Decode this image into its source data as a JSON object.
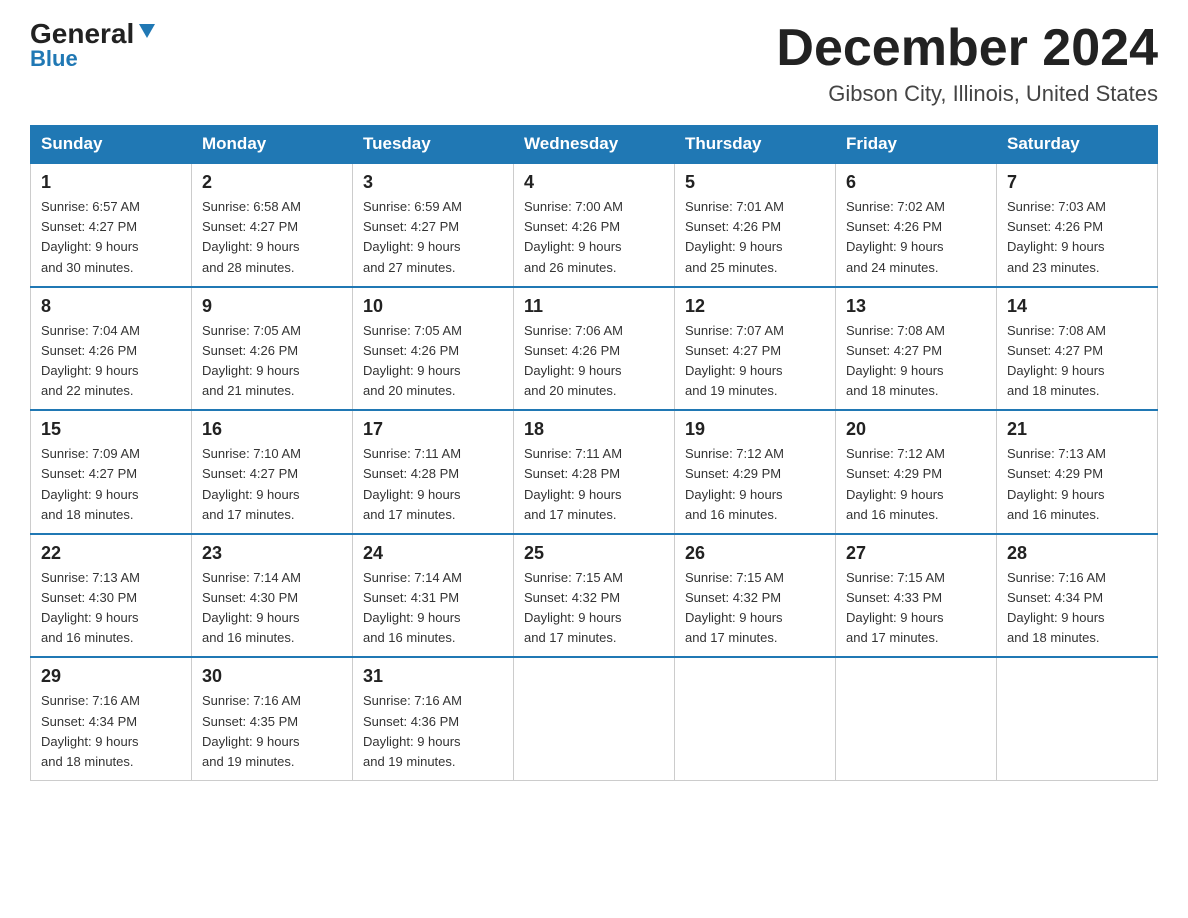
{
  "header": {
    "logo_general": "General",
    "logo_blue": "Blue",
    "month_title": "December 2024",
    "location": "Gibson City, Illinois, United States"
  },
  "days_of_week": [
    "Sunday",
    "Monday",
    "Tuesday",
    "Wednesday",
    "Thursday",
    "Friday",
    "Saturday"
  ],
  "weeks": [
    [
      {
        "day": "1",
        "sunrise": "6:57 AM",
        "sunset": "4:27 PM",
        "daylight": "9 hours and 30 minutes."
      },
      {
        "day": "2",
        "sunrise": "6:58 AM",
        "sunset": "4:27 PM",
        "daylight": "9 hours and 28 minutes."
      },
      {
        "day": "3",
        "sunrise": "6:59 AM",
        "sunset": "4:27 PM",
        "daylight": "9 hours and 27 minutes."
      },
      {
        "day": "4",
        "sunrise": "7:00 AM",
        "sunset": "4:26 PM",
        "daylight": "9 hours and 26 minutes."
      },
      {
        "day": "5",
        "sunrise": "7:01 AM",
        "sunset": "4:26 PM",
        "daylight": "9 hours and 25 minutes."
      },
      {
        "day": "6",
        "sunrise": "7:02 AM",
        "sunset": "4:26 PM",
        "daylight": "9 hours and 24 minutes."
      },
      {
        "day": "7",
        "sunrise": "7:03 AM",
        "sunset": "4:26 PM",
        "daylight": "9 hours and 23 minutes."
      }
    ],
    [
      {
        "day": "8",
        "sunrise": "7:04 AM",
        "sunset": "4:26 PM",
        "daylight": "9 hours and 22 minutes."
      },
      {
        "day": "9",
        "sunrise": "7:05 AM",
        "sunset": "4:26 PM",
        "daylight": "9 hours and 21 minutes."
      },
      {
        "day": "10",
        "sunrise": "7:05 AM",
        "sunset": "4:26 PM",
        "daylight": "9 hours and 20 minutes."
      },
      {
        "day": "11",
        "sunrise": "7:06 AM",
        "sunset": "4:26 PM",
        "daylight": "9 hours and 20 minutes."
      },
      {
        "day": "12",
        "sunrise": "7:07 AM",
        "sunset": "4:27 PM",
        "daylight": "9 hours and 19 minutes."
      },
      {
        "day": "13",
        "sunrise": "7:08 AM",
        "sunset": "4:27 PM",
        "daylight": "9 hours and 18 minutes."
      },
      {
        "day": "14",
        "sunrise": "7:08 AM",
        "sunset": "4:27 PM",
        "daylight": "9 hours and 18 minutes."
      }
    ],
    [
      {
        "day": "15",
        "sunrise": "7:09 AM",
        "sunset": "4:27 PM",
        "daylight": "9 hours and 18 minutes."
      },
      {
        "day": "16",
        "sunrise": "7:10 AM",
        "sunset": "4:27 PM",
        "daylight": "9 hours and 17 minutes."
      },
      {
        "day": "17",
        "sunrise": "7:11 AM",
        "sunset": "4:28 PM",
        "daylight": "9 hours and 17 minutes."
      },
      {
        "day": "18",
        "sunrise": "7:11 AM",
        "sunset": "4:28 PM",
        "daylight": "9 hours and 17 minutes."
      },
      {
        "day": "19",
        "sunrise": "7:12 AM",
        "sunset": "4:29 PM",
        "daylight": "9 hours and 16 minutes."
      },
      {
        "day": "20",
        "sunrise": "7:12 AM",
        "sunset": "4:29 PM",
        "daylight": "9 hours and 16 minutes."
      },
      {
        "day": "21",
        "sunrise": "7:13 AM",
        "sunset": "4:29 PM",
        "daylight": "9 hours and 16 minutes."
      }
    ],
    [
      {
        "day": "22",
        "sunrise": "7:13 AM",
        "sunset": "4:30 PM",
        "daylight": "9 hours and 16 minutes."
      },
      {
        "day": "23",
        "sunrise": "7:14 AM",
        "sunset": "4:30 PM",
        "daylight": "9 hours and 16 minutes."
      },
      {
        "day": "24",
        "sunrise": "7:14 AM",
        "sunset": "4:31 PM",
        "daylight": "9 hours and 16 minutes."
      },
      {
        "day": "25",
        "sunrise": "7:15 AM",
        "sunset": "4:32 PM",
        "daylight": "9 hours and 17 minutes."
      },
      {
        "day": "26",
        "sunrise": "7:15 AM",
        "sunset": "4:32 PM",
        "daylight": "9 hours and 17 minutes."
      },
      {
        "day": "27",
        "sunrise": "7:15 AM",
        "sunset": "4:33 PM",
        "daylight": "9 hours and 17 minutes."
      },
      {
        "day": "28",
        "sunrise": "7:16 AM",
        "sunset": "4:34 PM",
        "daylight": "9 hours and 18 minutes."
      }
    ],
    [
      {
        "day": "29",
        "sunrise": "7:16 AM",
        "sunset": "4:34 PM",
        "daylight": "9 hours and 18 minutes."
      },
      {
        "day": "30",
        "sunrise": "7:16 AM",
        "sunset": "4:35 PM",
        "daylight": "9 hours and 19 minutes."
      },
      {
        "day": "31",
        "sunrise": "7:16 AM",
        "sunset": "4:36 PM",
        "daylight": "9 hours and 19 minutes."
      },
      null,
      null,
      null,
      null
    ]
  ],
  "labels": {
    "sunrise": "Sunrise:",
    "sunset": "Sunset:",
    "daylight": "Daylight:"
  }
}
